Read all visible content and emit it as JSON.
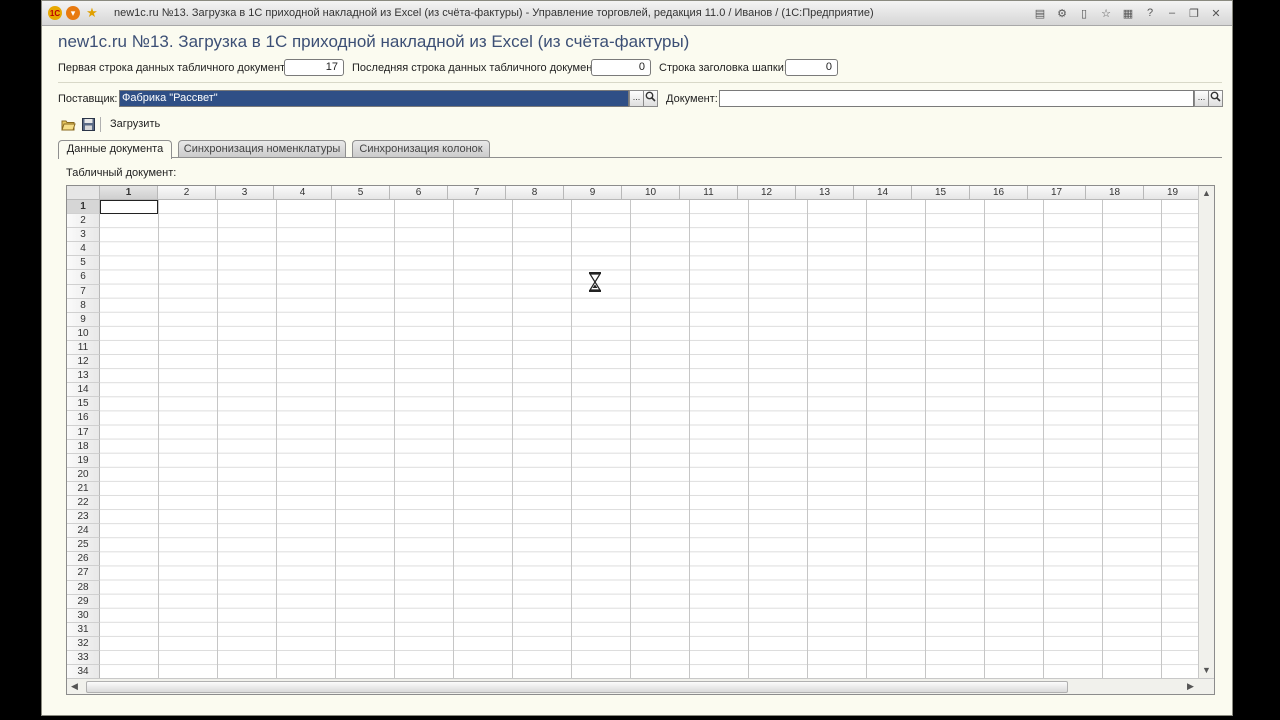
{
  "window": {
    "title": "new1c.ru №13.   Загрузка в 1С приходной накладной из Excel (из счёта-фактуры) - Управление торговлей, редакция 11.0 / Иванов /  (1С:Предприятие)",
    "logo": "1С"
  },
  "form": {
    "title": "new1c.ru №13.    Загрузка в 1С приходной накладной из Excel (из счёта-фактуры)",
    "first_row_label": "Первая строка данных табличного документа:",
    "first_row_value": "17",
    "last_row_label": "Последняя строка данных табличного документа:",
    "last_row_value": "0",
    "header_row_label": "Строка заголовка шапки:",
    "header_row_value": "0",
    "supplier_label": "Поставщик:",
    "supplier_value": "Фабрика \"Рассвет\"",
    "document_label": "Документ:",
    "document_value": "",
    "ellipsis": "...",
    "load_label": "Загрузить"
  },
  "tabs": [
    {
      "label": "Данные документа",
      "active": true
    },
    {
      "label": "Синхронизация номенклатуры",
      "active": false
    },
    {
      "label": "Синхронизация колонок",
      "active": false
    }
  ],
  "table": {
    "label": "Табличный документ:",
    "columns": [
      "1",
      "2",
      "3",
      "4",
      "5",
      "6",
      "7",
      "8",
      "9",
      "10",
      "11",
      "12",
      "13",
      "14",
      "15",
      "16",
      "17",
      "18",
      "19"
    ],
    "rows": [
      "1",
      "2",
      "3",
      "4",
      "5",
      "6",
      "7",
      "8",
      "9",
      "10",
      "11",
      "12",
      "13",
      "14",
      "15",
      "16",
      "17",
      "18",
      "19",
      "20",
      "21",
      "22",
      "23",
      "24",
      "25",
      "26",
      "27",
      "28",
      "29",
      "30",
      "31",
      "32",
      "33",
      "34"
    ]
  },
  "icons": {
    "app": "1c-logo-icon",
    "open_folder": "open-folder-icon",
    "save": "save-disk-icon",
    "search": "magnifier-icon",
    "cursor": "hourglass-icon"
  },
  "colors": {
    "selection": "#2f4f86",
    "title_text": "#3c4f75",
    "background": "#fbfbf0"
  }
}
